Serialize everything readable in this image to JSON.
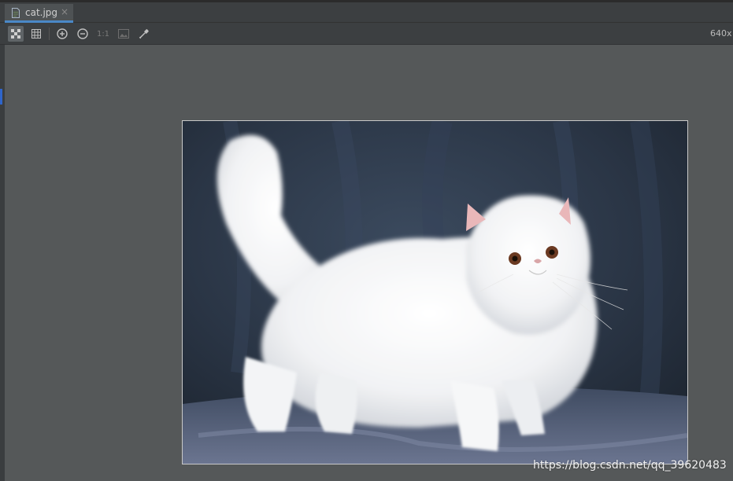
{
  "tab": {
    "label": "cat.jpg",
    "close_glyph": "×",
    "icon": "image-file-icon"
  },
  "toolbar": {
    "buttons": [
      {
        "name": "chessboard-background-icon",
        "active": true
      },
      {
        "name": "grid-icon"
      },
      {
        "name": "zoom-in-icon"
      },
      {
        "name": "zoom-out-icon"
      },
      {
        "name": "actual-size",
        "label": "1:1"
      },
      {
        "name": "fit-to-window-icon"
      },
      {
        "name": "color-picker-icon"
      }
    ],
    "size_info": "640x"
  },
  "image": {
    "description_icon": "cat-image"
  },
  "watermark": "https://blog.csdn.net/qq_39620483",
  "colors": {
    "tab_accent": "#4a88c7",
    "canvas": "#555859",
    "background": "#3c3f41"
  }
}
